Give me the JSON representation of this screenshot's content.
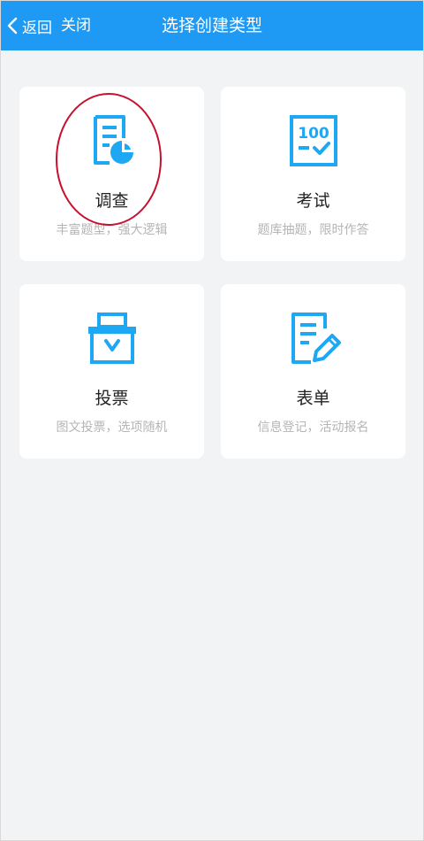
{
  "header": {
    "back_label": "返回",
    "close_label": "关闭",
    "title": "选择创建类型",
    "background": "#1e9af5"
  },
  "cards": [
    {
      "name": "调查",
      "desc": "丰富题型，强大逻辑",
      "icon": "survey-icon"
    },
    {
      "name": "考试",
      "desc": "题库抽题，限时作答",
      "icon": "exam-icon"
    },
    {
      "name": "投票",
      "desc": "图文投票，选项随机",
      "icon": "vote-icon"
    },
    {
      "name": "表单",
      "desc": "信息登记，活动报名",
      "icon": "form-icon"
    }
  ],
  "icon_color": "#1ea7f2",
  "annotation_color": "#c8102e"
}
